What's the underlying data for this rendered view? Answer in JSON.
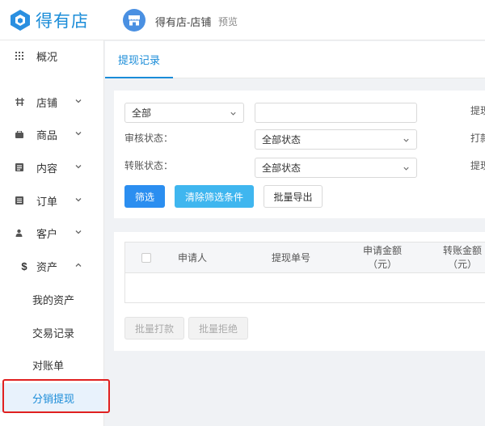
{
  "app": {
    "logo_text": "得有店",
    "shop_name": "得有店-店铺",
    "preview_label": "预览"
  },
  "sidebar": {
    "items": [
      {
        "label": "概况",
        "icon": "grid-icon"
      },
      {
        "label": "店铺",
        "icon": "shop-icon"
      },
      {
        "label": "商品",
        "icon": "goods-icon"
      },
      {
        "label": "内容",
        "icon": "content-icon"
      },
      {
        "label": "订单",
        "icon": "order-icon"
      },
      {
        "label": "客户",
        "icon": "customer-icon"
      },
      {
        "label": "资产",
        "icon": "dollar-icon"
      }
    ],
    "sub_items": [
      {
        "label": "我的资产"
      },
      {
        "label": "交易记录"
      },
      {
        "label": "对账单"
      },
      {
        "label": "分销提现",
        "active": true
      }
    ]
  },
  "tabs": [
    {
      "label": "提现记录",
      "active": true
    }
  ],
  "filters": {
    "type_select": {
      "value": "全部"
    },
    "keyword_input": {
      "value": ""
    },
    "audit_status": {
      "label": "审核状态：",
      "value": "全部状态"
    },
    "transfer_status": {
      "label": "转账状态：",
      "value": "全部状态"
    },
    "right_labels": [
      "提现",
      "打款",
      "提现"
    ],
    "buttons": {
      "filter": "筛选",
      "clear": "清除筛选条件",
      "export": "批量导出"
    }
  },
  "table": {
    "columns": [
      {
        "label": "申请人"
      },
      {
        "label": "提现单号"
      },
      {
        "label": "申请金额",
        "sub": "（元）"
      },
      {
        "label": "转账金额",
        "sub": "（元）"
      }
    ],
    "rows": [],
    "buttons": {
      "batch_pay": "批量打款",
      "batch_reject": "批量拒绝"
    }
  },
  "colors": {
    "primary": "#2b8ef0",
    "brand": "#1a8cd8",
    "highlight": "#e02020"
  }
}
